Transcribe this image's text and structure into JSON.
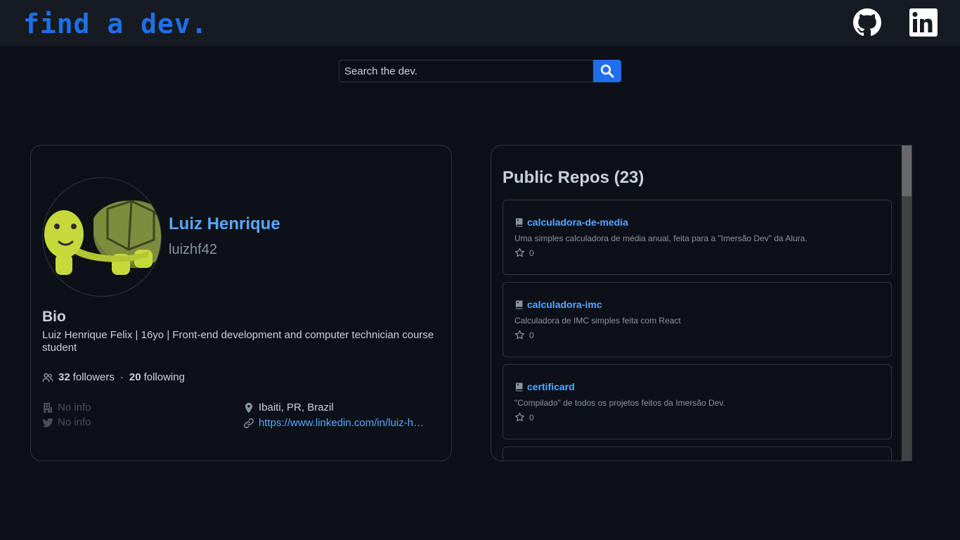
{
  "header": {
    "logo": "find a dev.",
    "icons": [
      "github-icon",
      "linkedin-icon"
    ]
  },
  "search": {
    "placeholder": "Search the dev.",
    "icon": "search-icon"
  },
  "profile": {
    "name": "Luiz Henrique",
    "login": "luizhf42",
    "avatar_icon": "turtle-avatar",
    "bio_title": "Bio",
    "bio": "Luiz Henrique Felix | 16yo | Front-end development and computer technician course student",
    "followers_count": "32",
    "followers_label": "followers",
    "separator": "·",
    "following_count": "20",
    "following_label": "following",
    "company": "No info",
    "twitter": "No info",
    "location": "Ibaiti, PR, Brazil",
    "blog": "https://www.linkedin.com/in/luiz-h…"
  },
  "repos": {
    "title": "Public Repos (23)",
    "items": [
      {
        "name": "calculadora-de-media",
        "description": "Uma simples calculadora de média anual, feita para a \"Imersão Dev\" da Alura.",
        "stars": "0"
      },
      {
        "name": "calculadora-imc",
        "description": "Calculadora de IMC simples feita com React",
        "stars": "0"
      },
      {
        "name": "certificard",
        "description": "\"Compilado\" de todos os projetos feitos da Imersão Dev.",
        "stars": "0"
      }
    ]
  },
  "colors": {
    "background": "#0d1117",
    "header": "#161b22",
    "accent": "#1f6feb",
    "link": "#58a6ff",
    "border": "#30363d"
  }
}
